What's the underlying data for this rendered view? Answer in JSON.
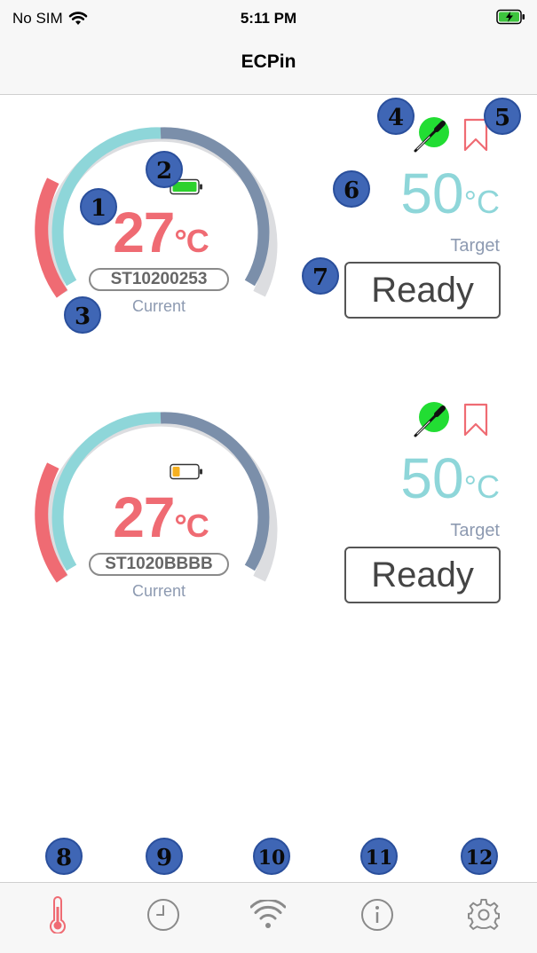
{
  "status_bar": {
    "carrier": "No SIM",
    "time": "5:11 PM"
  },
  "nav": {
    "title": "ECPin"
  },
  "devices": [
    {
      "current_temp": "27",
      "current_unit": "°C",
      "serial": "ST10200253",
      "current_label": "Current",
      "target_temp": "50",
      "target_unit": "°C",
      "target_label": "Target",
      "ready_label": "Ready",
      "battery_level": 1.0,
      "battery_color": "#2ed12e"
    },
    {
      "current_temp": "27",
      "current_unit": "°C",
      "serial": "ST1020BBBB",
      "current_label": "Current",
      "target_temp": "50",
      "target_unit": "°C",
      "target_label": "Target",
      "ready_label": "Ready",
      "battery_level": 0.3,
      "battery_color": "#f5b021"
    }
  ],
  "markers": [
    "1",
    "2",
    "3",
    "4",
    "5",
    "6",
    "7",
    "8",
    "9",
    "10",
    "11",
    "12"
  ],
  "tabs": [
    {
      "name": "thermometer-icon",
      "active": true
    },
    {
      "name": "clock-icon",
      "active": false
    },
    {
      "name": "wifi-icon",
      "active": false
    },
    {
      "name": "info-icon",
      "active": false
    },
    {
      "name": "gear-icon",
      "active": false
    }
  ],
  "colors": {
    "accent_red": "#ef6b73",
    "accent_teal": "#8ed6d9",
    "gauge_blue": "#7b8faa",
    "gauge_gray": "#dcdde0",
    "marker_blue": "#3f66b5"
  }
}
